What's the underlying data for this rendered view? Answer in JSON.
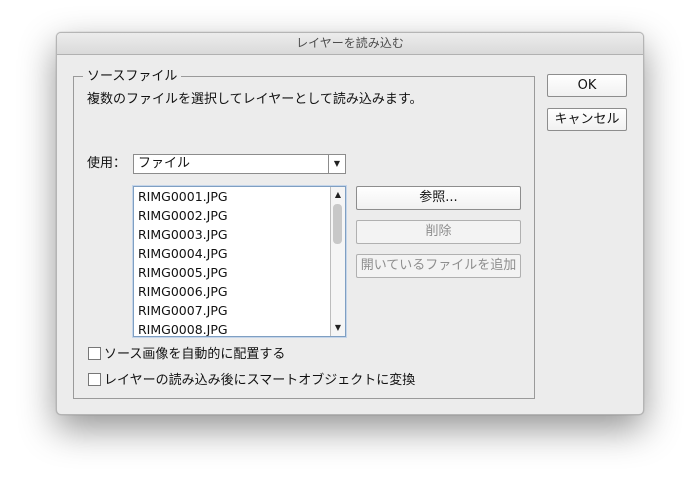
{
  "window": {
    "title": "レイヤーを読み込む"
  },
  "source_group": {
    "title": "ソースファイル",
    "description": "複数のファイルを選択してレイヤーとして読み込みます。",
    "use_label": "使用：",
    "use_select": {
      "selected": "ファイル"
    },
    "file_list": [
      "RIMG0001.JPG",
      "RIMG0002.JPG",
      "RIMG0003.JPG",
      "RIMG0004.JPG",
      "RIMG0005.JPG",
      "RIMG0006.JPG",
      "RIMG0007.JPG",
      "RIMG0008.JPG"
    ],
    "buttons": {
      "browse": "参照...",
      "remove": "削除",
      "add_open": "開いているファイルを追加"
    },
    "options": {
      "auto_align": {
        "label": "ソース画像を自動的に配置する",
        "checked": false
      },
      "smart_object": {
        "label": "レイヤーの読み込み後にスマートオブジェクトに変換",
        "checked": false
      }
    }
  },
  "dialog_buttons": {
    "ok": "OK",
    "cancel": "キャンセル"
  },
  "icons": {
    "select_arrow": "chevron-down-icon",
    "scroll_up": "scroll-up-arrow-icon",
    "scroll_down": "scroll-down-arrow-icon"
  }
}
